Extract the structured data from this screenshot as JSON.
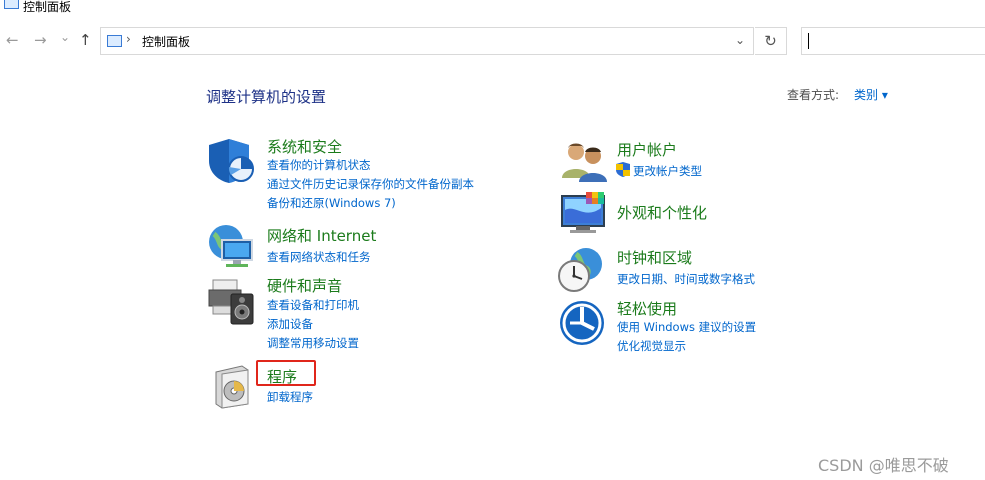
{
  "window": {
    "title": "控制面板"
  },
  "nav": {
    "back": "←",
    "forward": "→",
    "recent": "⌄",
    "up": "↑"
  },
  "address": {
    "separator": "›",
    "path": "控制面板",
    "dropdown": "⌄",
    "refresh": "↻"
  },
  "search": {
    "value": ""
  },
  "main": {
    "heading": "调整计算机的设置",
    "view_by_label": "查看方式:",
    "view_by_value": "类别 ▾"
  },
  "left_categories": [
    {
      "title": "系统和安全",
      "links": [
        "查看你的计算机状态",
        "通过文件历史记录保存你的文件备份副本",
        "备份和还原(Windows 7)"
      ]
    },
    {
      "title": "网络和 Internet",
      "links": [
        "查看网络状态和任务"
      ]
    },
    {
      "title": "硬件和声音",
      "links": [
        "查看设备和打印机",
        "添加设备",
        "调整常用移动设置"
      ]
    },
    {
      "title": "程序",
      "links": [
        "卸载程序"
      ]
    }
  ],
  "right_categories": [
    {
      "title": "用户帐户",
      "links": [
        "更改帐户类型"
      ]
    },
    {
      "title": "外观和个性化",
      "links": []
    },
    {
      "title": "时钟和区域",
      "links": [
        "更改日期、时间或数字格式"
      ]
    },
    {
      "title": "轻松使用",
      "links": [
        "使用 Windows 建议的设置",
        "优化视觉显示"
      ]
    }
  ],
  "watermark": "CSDN @唯思不破",
  "colors": {
    "title_green": "#1b7b1b",
    "link_blue": "#0066cc",
    "heading_blue": "#1e3287",
    "highlight_red": "#e0261b"
  }
}
